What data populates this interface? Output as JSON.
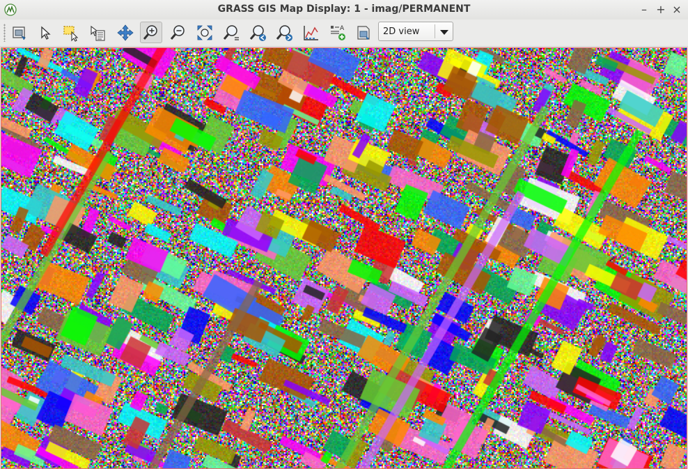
{
  "window": {
    "title": "GRASS GIS Map Display: 1 - imag/PERMANENT",
    "minimize_glyph": "–",
    "maximize_glyph": "+",
    "close_glyph": "×"
  },
  "toolbar": {
    "buttons": [
      {
        "name": "display-map-button",
        "icon": "display-map-icon"
      },
      {
        "name": "pointer-button",
        "icon": "pointer-icon"
      },
      {
        "name": "select-button",
        "icon": "select-icon"
      },
      {
        "name": "query-button",
        "icon": "query-icon"
      },
      {
        "name": "pan-button",
        "icon": "pan-icon"
      },
      {
        "name": "zoom-in-button",
        "icon": "zoom-in-icon",
        "active": true
      },
      {
        "name": "zoom-out-button",
        "icon": "zoom-out-icon"
      },
      {
        "name": "zoom-extent-button",
        "icon": "zoom-extent-icon"
      },
      {
        "name": "zoom-menu-button",
        "icon": "zoom-menu-icon"
      },
      {
        "name": "zoom-back-button",
        "icon": "zoom-back-icon"
      },
      {
        "name": "zoom-forward-button",
        "icon": "zoom-forward-icon"
      },
      {
        "name": "analyze-button",
        "icon": "analyze-icon"
      },
      {
        "name": "decoration-button",
        "icon": "decoration-icon"
      },
      {
        "name": "save-image-button",
        "icon": "save-image-icon"
      }
    ],
    "view_mode": {
      "selected": "2D view"
    },
    "decoration_glyph": "A"
  },
  "map": {
    "description_colors": [
      "#ff00ff",
      "#00ff00",
      "#0000ff",
      "#ffff00",
      "#00ffff",
      "#ff0000",
      "#ff8800",
      "#8800ff",
      "#00aa55",
      "#aa5500"
    ]
  }
}
